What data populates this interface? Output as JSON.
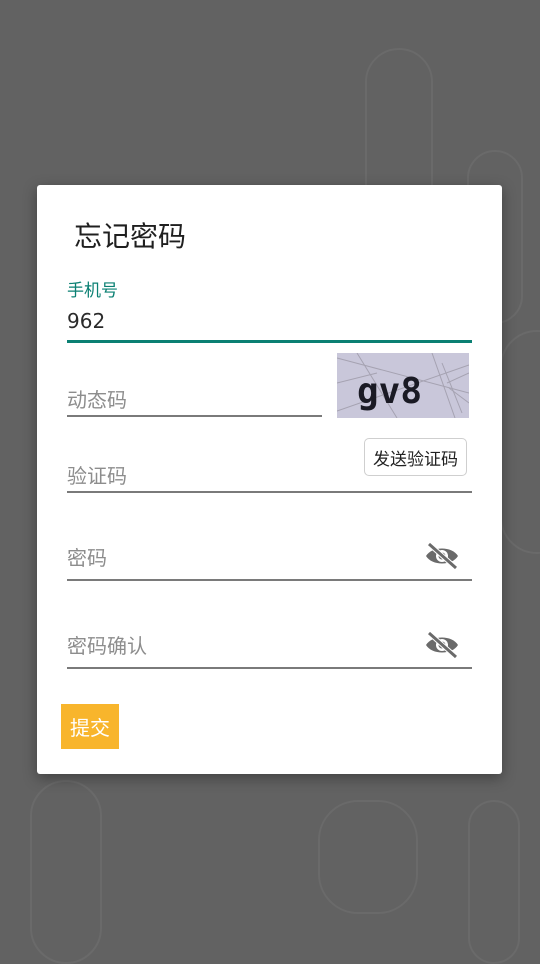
{
  "dialog": {
    "title": "忘记密码",
    "phone": {
      "label": "手机号",
      "value": "962"
    },
    "dynamic_code": {
      "placeholder": "动态码"
    },
    "captcha": {
      "text": "gv8"
    },
    "verify_code": {
      "placeholder": "验证码",
      "send_button": "发送验证码"
    },
    "password": {
      "placeholder": "密码",
      "icon": "eye-slash-icon"
    },
    "password_confirm": {
      "placeholder": "密码确认",
      "icon": "eye-slash-icon"
    },
    "submit_label": "提交"
  },
  "colors": {
    "accent": "#0b8073",
    "submit": "#f8b52c",
    "backdrop": "#626262"
  }
}
